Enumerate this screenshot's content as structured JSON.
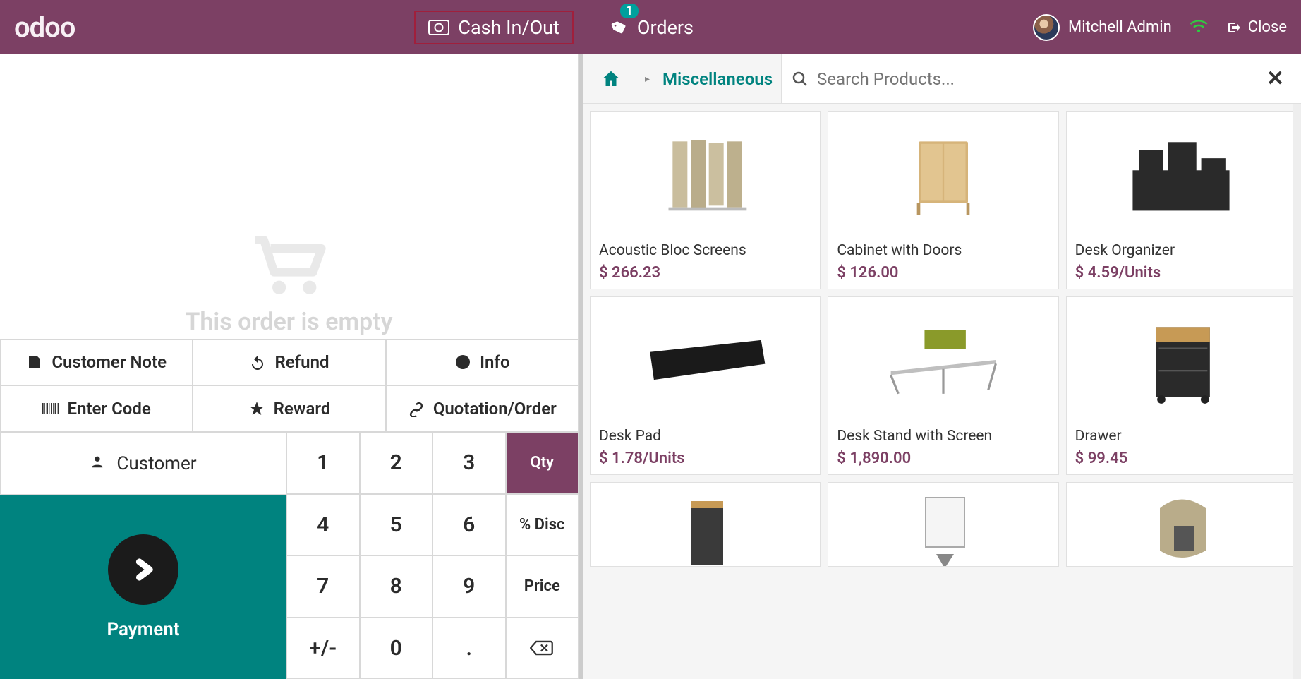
{
  "header": {
    "logo": "odoo",
    "cash_in_out": "Cash In/Out",
    "orders": "Orders",
    "orders_badge": "1",
    "user_name": "Mitchell Admin",
    "close": "Close"
  },
  "order": {
    "empty_text": "This order is empty"
  },
  "actions": {
    "customer_note": "Customer Note",
    "refund": "Refund",
    "info": "Info",
    "enter_code": "Enter Code",
    "reward": "Reward",
    "quotation_order": "Quotation/Order"
  },
  "customer_button": "Customer",
  "payment_button": "Payment",
  "keypad": {
    "k1": "1",
    "k2": "2",
    "k3": "3",
    "qty": "Qty",
    "k4": "4",
    "k5": "5",
    "k6": "6",
    "disc": "% Disc",
    "k7": "7",
    "k8": "8",
    "k9": "9",
    "price": "Price",
    "pm": "+/-",
    "k0": "0",
    "dot": ".",
    "bsp": "⌫"
  },
  "products_bar": {
    "category": "Miscellaneous",
    "search_placeholder": "Search Products..."
  },
  "products": [
    {
      "name": "Acoustic Bloc Screens",
      "price": "$ 266.23"
    },
    {
      "name": "Cabinet with Doors",
      "price": "$ 126.00"
    },
    {
      "name": "Desk Organizer",
      "price": "$ 4.59/Units"
    },
    {
      "name": "Desk Pad",
      "price": "$ 1.78/Units"
    },
    {
      "name": "Desk Stand with Screen",
      "price": "$ 1,890.00"
    },
    {
      "name": "Drawer",
      "price": "$ 99.45"
    }
  ]
}
